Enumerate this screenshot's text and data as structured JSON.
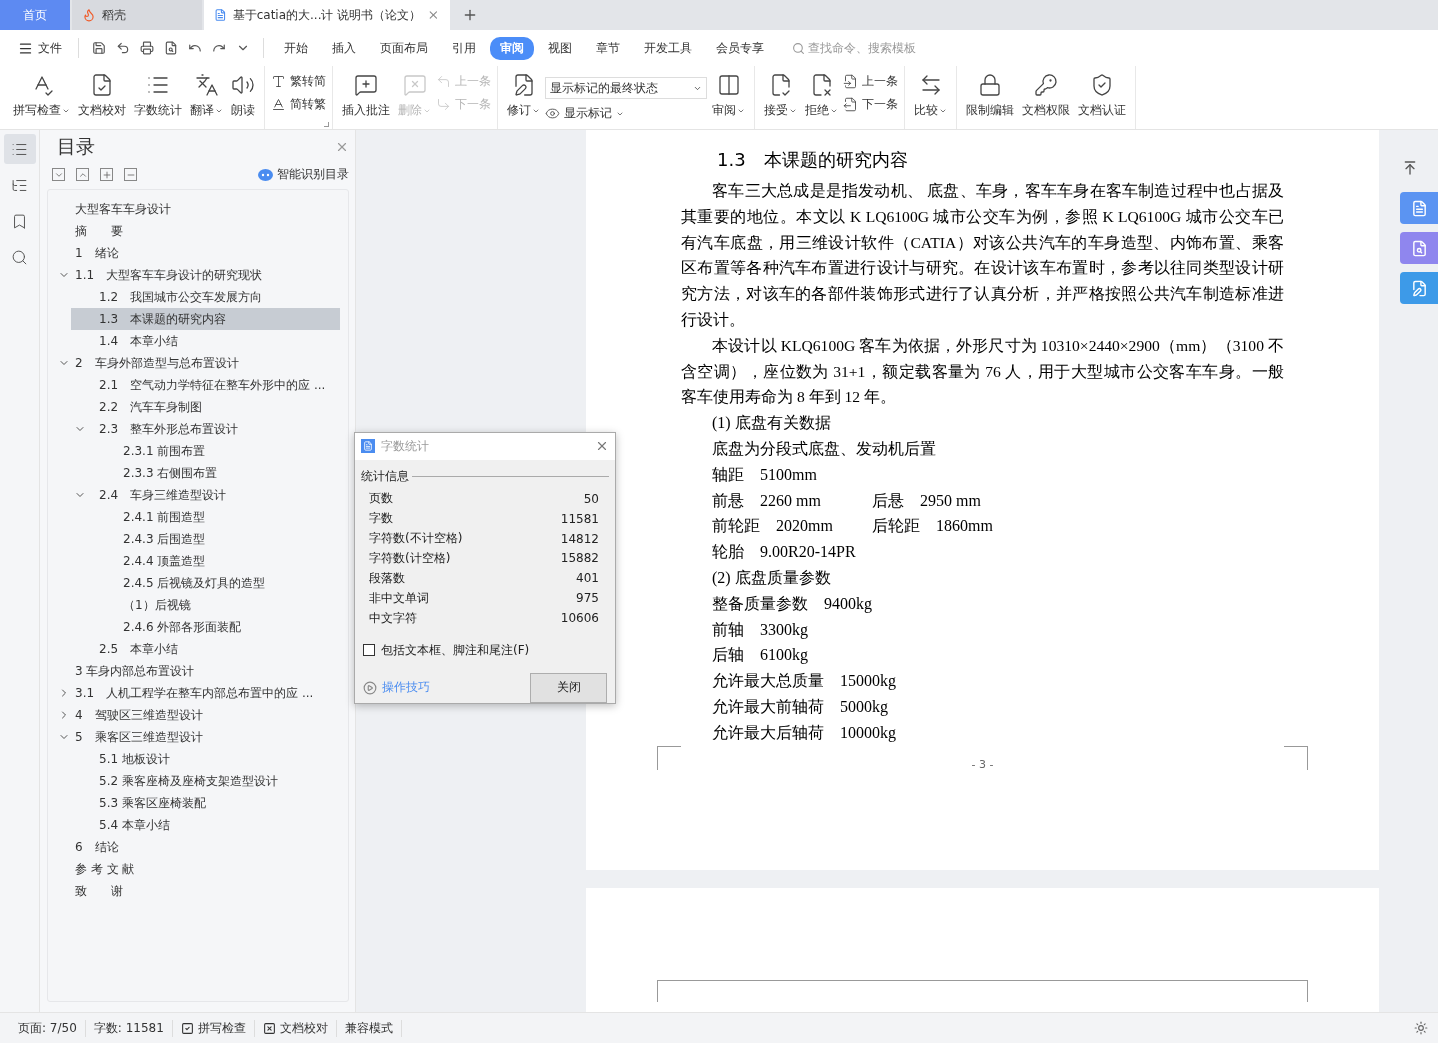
{
  "tabs": [
    {
      "kind": "home",
      "label": "首页",
      "selected": false
    },
    {
      "kind": "docer",
      "label": "稻壳",
      "selected": false
    },
    {
      "kind": "doc",
      "label": "基于catia的大...计 说明书（论文）",
      "selected": true
    }
  ],
  "menu": {
    "file": "文件",
    "tabs": [
      {
        "label": "开始",
        "selected": false
      },
      {
        "label": "插入",
        "selected": false
      },
      {
        "label": "页面布局",
        "selected": false
      },
      {
        "label": "引用",
        "selected": false
      },
      {
        "label": "审阅",
        "selected": true
      },
      {
        "label": "视图",
        "selected": false
      },
      {
        "label": "章节",
        "selected": false
      },
      {
        "label": "开发工具",
        "selected": false
      },
      {
        "label": "会员专享",
        "selected": false
      }
    ],
    "search": {
      "placeholder": "查找命令、搜索模板"
    }
  },
  "ribbon": [
    {
      "items": [
        {
          "kind": "large",
          "label": "拼写检查",
          "dropdown": true,
          "disabled": false
        },
        {
          "kind": "large",
          "label": "文档校对",
          "dropdown": false,
          "disabled": false
        },
        {
          "kind": "large",
          "label": "字数统计",
          "dropdown": false,
          "disabled": false
        },
        {
          "kind": "large",
          "label": "翻译",
          "dropdown": true,
          "disabled": false
        },
        {
          "kind": "large",
          "label": "朗读",
          "dropdown": false,
          "disabled": false
        }
      ]
    },
    {
      "items": [
        {
          "kind": "pair",
          "items": [
            {
              "label": "繁转简",
              "disabled": false
            },
            {
              "label": "简转繁",
              "disabled": false
            }
          ]
        }
      ]
    },
    {
      "items": [
        {
          "kind": "large",
          "label": "插入批注",
          "dropdown": false,
          "disabled": false
        },
        {
          "kind": "large",
          "label": "删除",
          "dropdown": true,
          "disabled": true
        },
        {
          "kind": "pair",
          "items": [
            {
              "label": "上一条",
              "disabled": true
            },
            {
              "label": "下一条",
              "disabled": true
            }
          ]
        }
      ]
    },
    {
      "items": [
        {
          "kind": "large",
          "label": "修订",
          "dropdown": true,
          "disabled": false
        },
        {
          "kind": "select",
          "value": "显示标记的最终状态",
          "sub": "显示标记"
        },
        {
          "kind": "large",
          "label": "审阅",
          "dropdown": true,
          "disabled": false
        }
      ]
    },
    {
      "items": [
        {
          "kind": "large",
          "label": "接受",
          "dropdown": true,
          "disabled": false
        },
        {
          "kind": "large",
          "label": "拒绝",
          "dropdown": true,
          "disabled": false
        },
        {
          "kind": "pair",
          "items": [
            {
              "label": "上一条",
              "disabled": false
            },
            {
              "label": "下一条",
              "disabled": false
            }
          ]
        }
      ]
    },
    {
      "items": [
        {
          "kind": "large",
          "label": "比较",
          "dropdown": true,
          "disabled": false
        }
      ]
    },
    {
      "items": [
        {
          "kind": "large",
          "label": "限制编辑",
          "dropdown": false,
          "disabled": false
        },
        {
          "kind": "large",
          "label": "文档权限",
          "dropdown": false,
          "disabled": false
        },
        {
          "kind": "large",
          "label": "文档认证",
          "dropdown": false,
          "disabled": false
        }
      ]
    }
  ],
  "side_tools": [
    {
      "selected": true
    },
    {
      "selected": false
    },
    {
      "selected": false
    },
    {
      "selected": false
    }
  ],
  "toc": {
    "title": "目录",
    "smart": "智能识别目录",
    "items": [
      {
        "label": "大型客车车身设计",
        "selected": false
      },
      {
        "label": "摘　　要",
        "selected": false
      },
      {
        "label": "1　绪论",
        "selected": false
      },
      {
        "label": "1.1　大型客车车身设计的研究现状",
        "selected": false,
        "expanded": true,
        "children": [
          {
            "label": "1.2　我国城市公交车发展方向",
            "selected": false
          },
          {
            "label": "1.3　本课题的研究内容",
            "selected": true
          },
          {
            "label": "1.4　本章小结",
            "selected": false
          }
        ]
      },
      {
        "label": "2　车身外部造型与总布置设计",
        "selected": false,
        "expanded": true,
        "children": [
          {
            "label": "2.1　空气动力学特征在整车外形中的应 ...",
            "selected": false
          },
          {
            "label": "2.2　汽车车身制图",
            "selected": false
          },
          {
            "label": "2.3　整车外形总布置设计",
            "selected": false,
            "expanded": true,
            "children": [
              {
                "label": "2.3.1 前围布置",
                "selected": false
              },
              {
                "label": "2.3.3 右侧围布置",
                "selected": false
              }
            ]
          },
          {
            "label": "2.4　车身三维造型设计",
            "selected": false,
            "expanded": true,
            "children": [
              {
                "label": "2.4.1 前围造型",
                "selected": false
              },
              {
                "label": "2.4.3 后围造型",
                "selected": false
              },
              {
                "label": "2.4.4 顶盖造型",
                "selected": false
              },
              {
                "label": "2.4.5 后视镜及灯具的造型",
                "selected": false
              },
              {
                "label": "（1）后视镜",
                "selected": false
              },
              {
                "label": "2.4.6 外部各形面装配",
                "selected": false
              }
            ]
          },
          {
            "label": "2.5　本章小结",
            "selected": false
          }
        ]
      },
      {
        "label": "3 车身内部总布置设计",
        "selected": false
      },
      {
        "label": "3.1　人机工程学在整车内部总布置中的应 ...",
        "selected": false,
        "expanded": false
      },
      {
        "label": "4　驾驶区三维造型设计",
        "selected": false,
        "expanded": false
      },
      {
        "label": "5　乘客区三维造型设计",
        "selected": false,
        "expanded": true,
        "children": [
          {
            "label": "5.1 地板设计",
            "selected": false
          },
          {
            "label": "5.2 乘客座椅及座椅支架造型设计",
            "selected": false
          },
          {
            "label": "5.3 乘客区座椅装配",
            "selected": false
          },
          {
            "label": "5.4 本章小结",
            "selected": false
          }
        ]
      },
      {
        "label": "6　结论",
        "selected": false
      },
      {
        "label": "参 考 文 献",
        "selected": false
      },
      {
        "label": "致　　谢",
        "selected": false
      }
    ]
  },
  "document": {
    "blocks": [
      {
        "kind": "heading",
        "text": "1.3　本课题的研究内容"
      },
      {
        "kind": "para",
        "text": "客车三大总成是是指发动机、 底盘、车身，客车车身在客车制造过程中也占据及其重要的地位。本文以 K LQ6100G 城市公交车为例，参照 K LQ6100G 城市公交车已有汽车底盘，用三维设计软件（CATIA）对该公共汽车的车身造型、内饰布置、乘客区布置等各种汽车布置进行设计与研究。在设计该车布置时，参考以往同类型设计研究方法，对该车的各部件装饰形式进行了认真分析，并严格按照公共汽车制造标准进行设计。"
      },
      {
        "kind": "para",
        "text": "本设计以 KLQ6100G 客车为依据，外形尺寸为 10310×2440×2900（mm）（3100 不含空调），座位数为 31+1，额定载客量为 76 人，用于大型城市公交客车车身。一般客车使用寿命为 8 年到 12 年。"
      },
      {
        "kind": "item",
        "text": "(1) 底盘有关数据"
      },
      {
        "kind": "item",
        "text": "底盘为分段式底盘、发动机后置"
      },
      {
        "kind": "spec",
        "cells": [
          "轴距　5100mm"
        ]
      },
      {
        "kind": "spec",
        "cells": [
          "前悬　2260 mm",
          "后悬　2950 mm"
        ]
      },
      {
        "kind": "spec",
        "cells": [
          "前轮距　2020mm",
          "后轮距　1860mm"
        ]
      },
      {
        "kind": "spec",
        "cells": [
          "轮胎　9.00R20-14PR"
        ]
      },
      {
        "kind": "item",
        "text": "(2) 底盘质量参数"
      },
      {
        "kind": "spec",
        "cells": [
          "整备质量参数　9400kg"
        ]
      },
      {
        "kind": "spec",
        "cells": [
          "前轴　3300kg"
        ]
      },
      {
        "kind": "spec",
        "cells": [
          "后轴　6100kg"
        ]
      },
      {
        "kind": "spec",
        "cells": [
          "允许最大总质量　15000kg"
        ]
      },
      {
        "kind": "spec",
        "cells": [
          "允许最大前轴荷　5000kg"
        ]
      },
      {
        "kind": "spec",
        "cells": [
          "允许最大后轴荷　10000kg"
        ]
      }
    ],
    "page_number": "- 3 -"
  },
  "dialog": {
    "title": "字数统计",
    "group": "统计信息",
    "rows": [
      {
        "label": "页数",
        "value": "50"
      },
      {
        "label": "字数",
        "value": "11581"
      },
      {
        "label": "字符数(不计空格)",
        "value": "14812"
      },
      {
        "label": "字符数(计空格)",
        "value": "15882"
      },
      {
        "label": "段落数",
        "value": "401"
      },
      {
        "label": "非中文单词",
        "value": "975"
      },
      {
        "label": "中文字符",
        "value": "10606"
      }
    ],
    "checkbox": {
      "label": "包括文本框、脚注和尾注(F)",
      "checked": false
    },
    "link": "操作技巧",
    "button": "关闭"
  },
  "status_bar": {
    "page": "页面: 7/50",
    "words": "字数: 11581",
    "spell": "拼写检查",
    "proof": "文档校对",
    "mode": "兼容模式"
  }
}
